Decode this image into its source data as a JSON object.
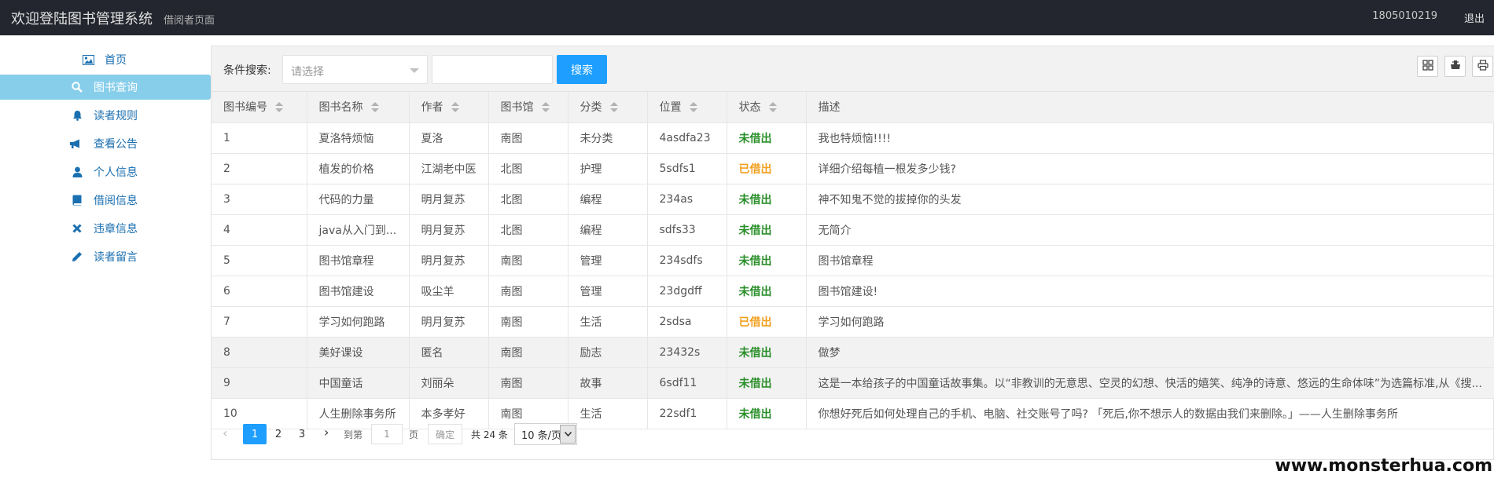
{
  "header": {
    "title": "欢迎登陆图书管理系统",
    "subtitle": "借阅者页面",
    "user_id": "1805010219",
    "logout_label": "退出"
  },
  "sidebar": {
    "items": [
      {
        "label": "首页",
        "icon": "picture-icon"
      },
      {
        "label": "图书查询",
        "icon": "search-icon",
        "active": true
      },
      {
        "label": "读者规则",
        "icon": "bell-icon"
      },
      {
        "label": "查看公告",
        "icon": "bullhorn-icon"
      },
      {
        "label": "个人信息",
        "icon": "user-icon"
      },
      {
        "label": "借阅信息",
        "icon": "book-icon"
      },
      {
        "label": "违章信息",
        "icon": "close-icon"
      },
      {
        "label": "读者留言",
        "icon": "pencil-icon"
      }
    ]
  },
  "search": {
    "label": "条件搜索:",
    "select_placeholder": "请选择",
    "input_value": "",
    "button_label": "搜索"
  },
  "toolbar_icons": [
    "columns-icon",
    "export-icon",
    "print-icon"
  ],
  "table": {
    "headers": [
      "图书编号",
      "图书名称",
      "作者",
      "图书馆",
      "分类",
      "位置",
      "状态",
      "描述"
    ],
    "rows": [
      [
        "1",
        "夏洛特烦恼",
        "夏洛",
        "南图",
        "未分类",
        "4asdfa23",
        "未借出",
        "我也特烦恼!!!!"
      ],
      [
        "2",
        "植发的价格",
        "江湖老中医",
        "北图",
        "护理",
        "5sdfs1",
        "已借出",
        "详细介绍每植一根发多少钱?"
      ],
      [
        "3",
        "代码的力量",
        "明月复苏",
        "北图",
        "编程",
        "234as",
        "未借出",
        "神不知鬼不觉的拔掉你的头发"
      ],
      [
        "4",
        "java从入门到...",
        "明月复苏",
        "北图",
        "编程",
        "sdfs33",
        "未借出",
        "无简介"
      ],
      [
        "5",
        "图书馆章程",
        "明月复苏",
        "南图",
        "管理",
        "234sdfs",
        "未借出",
        "图书馆章程"
      ],
      [
        "6",
        "图书馆建设",
        "吸尘羊",
        "南图",
        "管理",
        "23dgdff",
        "未借出",
        "图书馆建设!"
      ],
      [
        "7",
        "学习如何跑路",
        "明月复苏",
        "南图",
        "生活",
        "2sdsa",
        "已借出",
        "学习如何跑路"
      ],
      [
        "8",
        "美好课设",
        "匿名",
        "南图",
        "励志",
        "23432s",
        "未借出",
        "做梦"
      ],
      [
        "9",
        "中国童话",
        "刘丽朵",
        "南图",
        "故事",
        "6sdf11",
        "未借出",
        "这是一本给孩子的中国童话故事集。以“非教训的无意思、空灵的幻想、快活的嬉笑、纯净的诗意、悠远的生命体味”为选篇标准,从《搜..."
      ],
      [
        "10",
        "人生删除事务所",
        "本多孝好",
        "南图",
        "生活",
        "22sdf1",
        "未借出",
        "你想好死后如何处理自己的手机、电脑、社交账号了吗? 「死后,你不想示人的数据由我们来删除。」——人生删除事务所"
      ]
    ]
  },
  "status_colors": {
    "未借出": "#2a8f2a",
    "已借出": "#f0a020"
  },
  "pagination": {
    "pages": [
      "1",
      "2",
      "3"
    ],
    "current": "1",
    "goto_label": "到第",
    "goto_value": "1",
    "page_unit": "页",
    "confirm_label": "确定",
    "total_label": "共 24 条",
    "limit_value": "10 条/页"
  },
  "watermark": "www.monsterhua.com"
}
